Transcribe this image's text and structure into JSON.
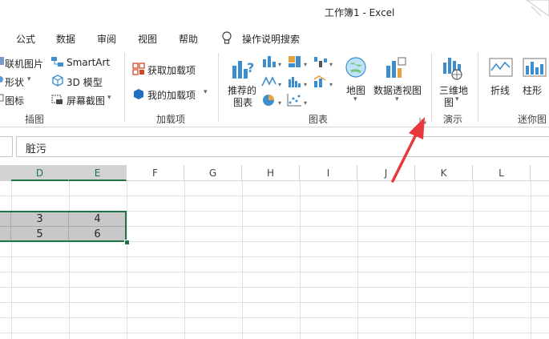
{
  "window": {
    "title": "工作簿1  -  Excel"
  },
  "tabs": [
    {
      "label": "公式"
    },
    {
      "label": "数据"
    },
    {
      "label": "审阅"
    },
    {
      "label": "视图"
    },
    {
      "label": "帮助"
    },
    {
      "label": "操作说明搜索"
    }
  ],
  "ribbon": {
    "illustrations": {
      "online_pictures": "联机图片",
      "smartart": "SmartArt",
      "shapes": "形状",
      "model3d": "3D 模型",
      "icons": "图标",
      "screenshot": "屏幕截图",
      "group_label": "插图"
    },
    "addins": {
      "get_addins": "获取加载项",
      "my_addins": "我的加载项",
      "group_label": "加载项"
    },
    "charts": {
      "recommended_line1": "推荐的",
      "recommended_line2": "图表",
      "maps": "地图",
      "pivotchart": "数据透视图",
      "group_label": "图表"
    },
    "tours": {
      "map3d_line1": "三维地",
      "map3d_line2": "图",
      "group_label": "演示"
    },
    "sparklines": {
      "line": "折线",
      "column": "柱形",
      "group_label": "迷你图"
    }
  },
  "formula_bar": {
    "value": "脏污"
  },
  "columns": [
    "D",
    "E",
    "F",
    "G",
    "H",
    "I",
    "J",
    "K",
    "L"
  ],
  "cells": [
    [
      "3",
      "4"
    ],
    [
      "5",
      "6"
    ]
  ],
  "colors": {
    "accent": "#217346",
    "arrow": "#e8383d"
  }
}
